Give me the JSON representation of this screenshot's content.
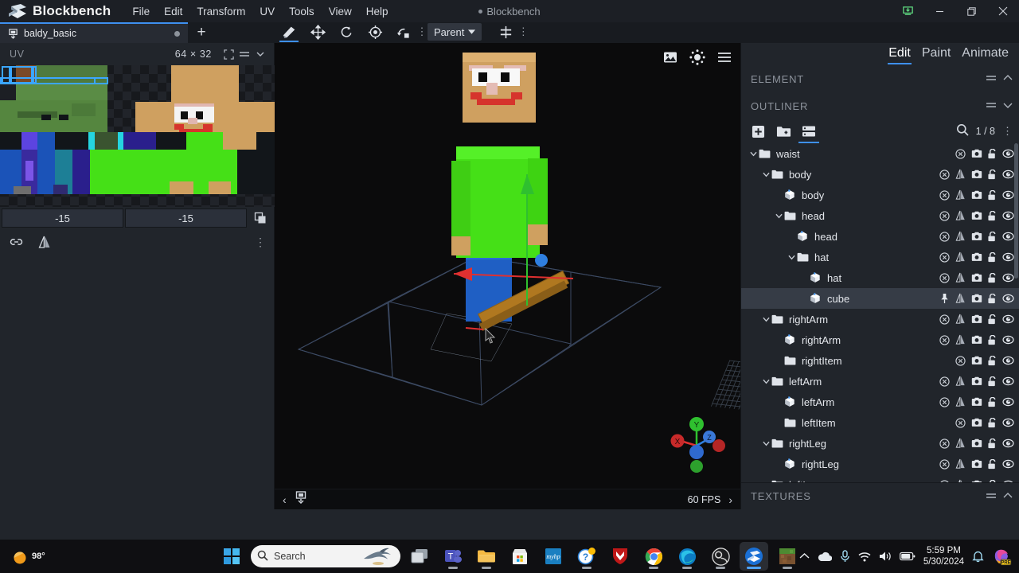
{
  "titlebar": {
    "app_name": "Blockbench",
    "window_title": "Blockbench",
    "menu": [
      "File",
      "Edit",
      "Transform",
      "UV",
      "Tools",
      "View",
      "Help"
    ],
    "controls": {
      "update": "update-icon",
      "minimize": "—",
      "maximize": "❐",
      "close": "✕"
    }
  },
  "tabs": {
    "items": [
      {
        "name": "baldy_basic",
        "modified": true
      }
    ],
    "new_tab_label": "+"
  },
  "toolbar": {
    "tools": [
      {
        "name": "move-tool",
        "active": true
      },
      {
        "name": "resize-tool",
        "active": false
      },
      {
        "name": "rotate-tool",
        "active": false
      },
      {
        "name": "pivot-tool",
        "active": false
      },
      {
        "name": "vertex-snap-tool",
        "active": false
      }
    ],
    "parent_dropdown": "Parent",
    "center_tool": "center-tool"
  },
  "uv_panel": {
    "title": "UV",
    "resolution": "64 × 32",
    "field_x": "-15",
    "field_y": "-15",
    "icons": [
      "fullscreen-icon",
      "menu-icon",
      "chevron-down-icon",
      "copy-icon",
      "link-icon",
      "mirror-icon",
      "more-icon"
    ]
  },
  "viewport": {
    "icons": [
      "image-icon",
      "brightness-icon",
      "menu-icon"
    ],
    "fps": "60 FPS",
    "prev_label": "‹",
    "next_label": "›",
    "gizmo": {
      "x": "X",
      "y": "Y",
      "z": "Z"
    }
  },
  "right_panel": {
    "modes": [
      {
        "label": "Edit",
        "active": true
      },
      {
        "label": "Paint",
        "active": false
      },
      {
        "label": "Animate",
        "active": false
      }
    ],
    "element_section": {
      "title": "ELEMENT",
      "collapsed": true
    },
    "outliner_section": {
      "title": "OUTLINER",
      "collapsed": false
    },
    "outliner_tools": {
      "add_cube": "add-cube-icon",
      "add_group": "add-group-icon",
      "list_view": "list-view-icon",
      "search": "search-icon",
      "count": "1 / 8",
      "more": "more-icon"
    },
    "outliner": [
      {
        "name": "waist",
        "type": "group",
        "depth": 0,
        "expanded": true,
        "selected": false,
        "mirror": false
      },
      {
        "name": "body",
        "type": "group",
        "depth": 1,
        "expanded": true,
        "selected": false,
        "mirror": true
      },
      {
        "name": "body",
        "type": "cube",
        "depth": 2,
        "expanded": null,
        "selected": false,
        "mirror": true
      },
      {
        "name": "head",
        "type": "group",
        "depth": 2,
        "expanded": true,
        "selected": false,
        "mirror": true
      },
      {
        "name": "head",
        "type": "cube",
        "depth": 3,
        "expanded": null,
        "selected": false,
        "mirror": true
      },
      {
        "name": "hat",
        "type": "group",
        "depth": 3,
        "expanded": true,
        "selected": false,
        "mirror": true
      },
      {
        "name": "hat",
        "type": "cube",
        "depth": 4,
        "expanded": null,
        "selected": false,
        "mirror": true
      },
      {
        "name": "cube",
        "type": "cube",
        "depth": 4,
        "expanded": null,
        "selected": true,
        "mirror": true
      },
      {
        "name": "rightArm",
        "type": "group",
        "depth": 1,
        "expanded": true,
        "selected": false,
        "mirror": true
      },
      {
        "name": "rightArm",
        "type": "cube",
        "depth": 2,
        "expanded": null,
        "selected": false,
        "mirror": true
      },
      {
        "name": "rightItem",
        "type": "group",
        "depth": 2,
        "expanded": null,
        "selected": false,
        "mirror": false
      },
      {
        "name": "leftArm",
        "type": "group",
        "depth": 1,
        "expanded": true,
        "selected": false,
        "mirror": true
      },
      {
        "name": "leftArm",
        "type": "cube",
        "depth": 2,
        "expanded": null,
        "selected": false,
        "mirror": true
      },
      {
        "name": "leftItem",
        "type": "group",
        "depth": 2,
        "expanded": null,
        "selected": false,
        "mirror": false
      },
      {
        "name": "rightLeg",
        "type": "group",
        "depth": 1,
        "expanded": true,
        "selected": false,
        "mirror": true
      },
      {
        "name": "rightLeg",
        "type": "cube",
        "depth": 2,
        "expanded": null,
        "selected": false,
        "mirror": true
      },
      {
        "name": "leftLeg",
        "type": "group",
        "depth": 1,
        "expanded": true,
        "selected": false,
        "mirror": true
      }
    ],
    "textures_section": {
      "title": "TEXTURES",
      "collapsed": true
    }
  },
  "taskbar": {
    "weather": "98°",
    "search_placeholder": "Search",
    "apps": [
      {
        "name": "task-view",
        "running": false,
        "active": false
      },
      {
        "name": "microsoft-teams",
        "running": true,
        "active": false
      },
      {
        "name": "file-explorer",
        "running": true,
        "active": false
      },
      {
        "name": "microsoft-store",
        "running": false,
        "active": false
      },
      {
        "name": "myhp",
        "running": false,
        "active": false
      },
      {
        "name": "help",
        "running": true,
        "active": false
      },
      {
        "name": "mcafee",
        "running": false,
        "active": false
      },
      {
        "name": "google-chrome",
        "running": true,
        "active": false
      },
      {
        "name": "microsoft-edge",
        "running": true,
        "active": false
      },
      {
        "name": "obs-studio",
        "running": true,
        "active": false
      },
      {
        "name": "blockbench",
        "running": true,
        "active": true
      },
      {
        "name": "minecraft",
        "running": true,
        "active": false
      }
    ],
    "tray": [
      "chevron-up-icon",
      "onedrive-icon",
      "microphone-icon",
      "wifi-icon",
      "volume-icon",
      "battery-icon"
    ],
    "time": "5:59 PM",
    "date": "5/30/2024",
    "notification": "bell-icon",
    "copilot": "PRE"
  },
  "colors": {
    "accent": "#3e90f0",
    "panel_bg": "#21252b",
    "panel_dark": "#1a1d22",
    "row_selected": "#363c46",
    "text": "#e4e7ec",
    "text_dim": "#8c929b",
    "shirt_green": "#45e017",
    "skin": "#d4a96a",
    "pants_blue": "#1f5fc4",
    "ruler_wood": "#b07820"
  }
}
